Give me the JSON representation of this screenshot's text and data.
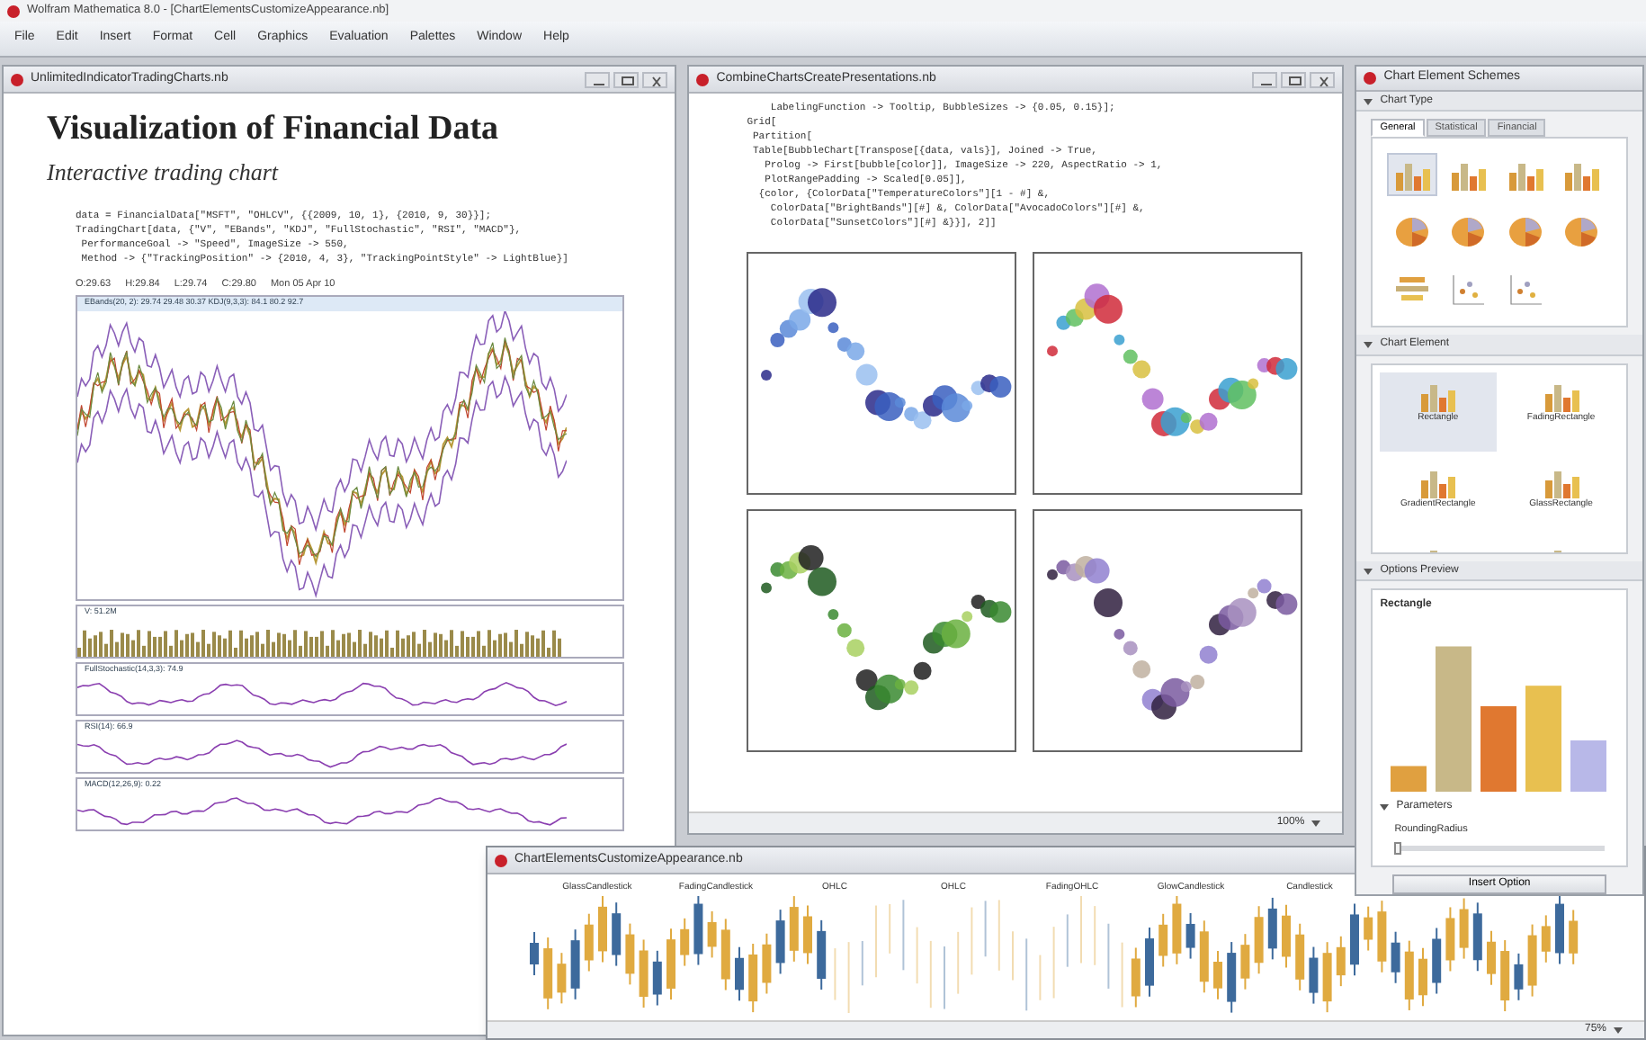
{
  "app_window": {
    "title": "Wolfram Mathematica 8.0 - [ChartElementsCustomizeAppearance.nb]"
  },
  "menu": [
    "File",
    "Edit",
    "Insert",
    "Format",
    "Cell",
    "Graphics",
    "Evaluation",
    "Palettes",
    "Window",
    "Help"
  ],
  "trading_notebook": {
    "title": "UnlimitedIndicatorTradingCharts.nb",
    "heading": "Visualization of Financial Data",
    "subtitle": "Interactive trading chart",
    "code": [
      "data = FinancialData[\"MSFT\", \"OHLCV\", {{2009, 10, 1}, {2010, 9, 30}}];",
      "TradingChart[data, {\"V\", \"EBands\", \"KDJ\", \"FullStochastic\", \"RSI\", \"MACD\"},",
      " PerformanceGoal -> \"Speed\", ImageSize -> 550,",
      " Method -> {\"TrackingPosition\" -> {2010, 4, 3}, \"TrackingPointStyle\" -> LightBlue}]"
    ],
    "ohlc": [
      "O:29.63",
      "H:29.84",
      "L:29.74",
      "C:29.80",
      "Mon 05 Apr 10"
    ],
    "chart_legend": "EBands(20, 2): 29.74  29.48  30.37   KDJ(9,3,3): 84.1  80.2  92.7",
    "indicator_labels": [
      "V: 51.2M",
      "FullStochastic(14,3,3): 74.9",
      "RSI(14): 66.9",
      "MACD(12,26,9): 0.22"
    ]
  },
  "bubble_notebook": {
    "title": "CombineChartsCreatePresentations.nb",
    "code": [
      "    LabelingFunction -> Tooltip, BubbleSizes -> {0.05, 0.15}];",
      "Grid[",
      " Partition[",
      " Table[BubbleChart[Transpose[{data, vals}], Joined -> True,",
      "   Prolog -> First[bubble[color]], ImageSize -> 220, AspectRatio -> 1,",
      "   PlotRangePadding -> Scaled[0.05]],",
      "  {color, {ColorData[\"TemperatureColors\"][1 - #] &,",
      "    ColorData[\"BrightBands\"][#] &, ColorData[\"AvocadoColors\"][#] &,",
      "    ColorData[\"SunsetColors\"][#] &}}], 2]]"
    ],
    "zoom": "100%"
  },
  "palette": {
    "title": "Chart Element Schemes",
    "chart_type": {
      "heading": "Chart Type",
      "tabs": [
        {
          "label": "General",
          "selected": true
        },
        {
          "label": "Statistical",
          "selected": false
        },
        {
          "label": "Financial",
          "selected": false
        }
      ],
      "icons": [
        {
          "kind": "bar",
          "selected": true
        },
        {
          "kind": "bar",
          "selected": false
        },
        {
          "kind": "bar",
          "selected": false
        },
        {
          "kind": "bar",
          "selected": false
        },
        {
          "kind": "pie",
          "selected": false
        },
        {
          "kind": "pie",
          "selected": false
        },
        {
          "kind": "pie",
          "selected": false
        },
        {
          "kind": "pie",
          "selected": false
        },
        {
          "kind": "stack",
          "selected": false
        },
        {
          "kind": "scatter",
          "selected": false
        },
        {
          "kind": "scatter",
          "selected": false
        }
      ]
    },
    "chart_element": {
      "heading": "Chart Element",
      "items": [
        {
          "label": "Rectangle",
          "selected": true
        },
        {
          "label": "FadingRectangle",
          "selected": false
        },
        {
          "label": "GradientRectangle",
          "selected": false
        },
        {
          "label": "GlassRectangle",
          "selected": false
        }
      ]
    },
    "options_preview": {
      "heading": "Options Preview",
      "title": "Rectangle",
      "parameters": "Parameters",
      "parameter": {
        "label": "RoundingRadius",
        "level": 0
      },
      "button": "Insert Option"
    }
  },
  "candlestick_notebook": {
    "title": "ChartElementsCustomizeAppearance.nb",
    "labels": [
      "GlassCandlestick",
      "FadingCandlestick",
      "OHLC",
      "OHLC",
      "FadingOHLC",
      "GlowCandlestick",
      "Candlestick"
    ],
    "zoom": "75%"
  }
}
